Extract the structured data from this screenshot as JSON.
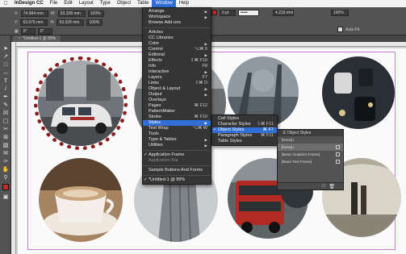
{
  "menubar": {
    "app": "InDesign CC",
    "items": [
      "File",
      "Edit",
      "Layout",
      "Type",
      "Object",
      "Table",
      "Window",
      "Help"
    ]
  },
  "control": {
    "x": "74.984 mm",
    "y": "63.976 mm",
    "w": "63.328 mm",
    "h": "63.328 mm",
    "scale_x": "100%",
    "scale_y": "100%",
    "angle": "0°",
    "shear": "0°",
    "stroke": "0 pt",
    "offset": "4.233 mm",
    "zoom": "100%",
    "autofit": "Auto-Fit"
  },
  "document_tab": "*Untitled-1 @ 89%",
  "window_menu": {
    "items": [
      {
        "label": "Arrange",
        "arrow": true
      },
      {
        "label": "Workspace",
        "arrow": true
      },
      {
        "label": "Browse Add-ons"
      },
      {
        "sep": true
      },
      {
        "label": "Articles"
      },
      {
        "label": "CC Libraries"
      },
      {
        "label": "Color",
        "arrow": true
      },
      {
        "label": "Control",
        "shortcut": "⌥⌘ 6"
      },
      {
        "label": "Editorial",
        "arrow": true
      },
      {
        "label": "Effects",
        "shortcut": "⇧⌘ F10"
      },
      {
        "label": "Info",
        "shortcut": "F8"
      },
      {
        "label": "Interactive",
        "arrow": true
      },
      {
        "label": "Layers",
        "shortcut": "F7"
      },
      {
        "label": "Links",
        "shortcut": "⇧⌘ D"
      },
      {
        "label": "Object & Layout",
        "arrow": true
      },
      {
        "label": "Output",
        "arrow": true
      },
      {
        "label": "Overlays"
      },
      {
        "label": "Pages",
        "shortcut": "⌘ F12"
      },
      {
        "label": "PatternMaker"
      },
      {
        "label": "Stroke",
        "shortcut": "⌘ F10"
      },
      {
        "label": "Styles",
        "arrow": true,
        "highlight": true
      },
      {
        "label": "Text Wrap",
        "shortcut": "⌥⌘ W"
      },
      {
        "label": "Tools"
      },
      {
        "label": "Type & Tables",
        "arrow": true
      },
      {
        "label": "Utilities",
        "arrow": true
      },
      {
        "sep": true
      },
      {
        "label": "Application Frame",
        "check": true
      },
      {
        "label": "Application Bar",
        "disabled": true
      },
      {
        "sep": true
      },
      {
        "label": "Sample Buttons And Forms"
      },
      {
        "sep": true
      },
      {
        "label": "*Untitled-1 @ 89%",
        "check": true
      }
    ]
  },
  "styles_submenu": {
    "items": [
      {
        "label": "Cell Styles"
      },
      {
        "label": "Character Styles",
        "shortcut": "⇧⌘ F11"
      },
      {
        "label": "Object Styles",
        "shortcut": "⌘ F7",
        "highlight": true,
        "check": true
      },
      {
        "label": "Paragraph Styles",
        "shortcut": "⌘ F11"
      },
      {
        "label": "Table Styles"
      }
    ]
  },
  "object_styles_panel": {
    "title": "Object Styles",
    "current": "[None]+",
    "rows": [
      {
        "label": "[None]+",
        "selected": true
      },
      {
        "label": "[Basic Graphics Frame]"
      },
      {
        "label": "[Basic Text Frame]"
      }
    ]
  },
  "images": [
    {
      "name": "london-taxi-photo",
      "colors": [
        "#5a5f63",
        "#b9b9b9",
        "#9a2a2a"
      ]
    },
    {
      "name": "city-street-partial-photo",
      "colors": [
        "#6c6f72",
        "#a0a3a6"
      ]
    },
    {
      "name": "foggy-street-photo",
      "colors": [
        "#586068",
        "#97a0a8"
      ]
    },
    {
      "name": "night-traffic-photo",
      "colors": [
        "#1b1f24",
        "#d8c48a"
      ]
    },
    {
      "name": "coffee-cup-photo",
      "colors": [
        "#7a5a3e",
        "#efe7dc"
      ]
    },
    {
      "name": "skyscraper-photo",
      "colors": [
        "#7f8488",
        "#c9cdd0"
      ]
    },
    {
      "name": "red-bus-photo",
      "colors": [
        "#b32a23",
        "#5d6466"
      ]
    },
    {
      "name": "bus-interior-photo",
      "colors": [
        "#2e3437",
        "#8b8f90"
      ]
    },
    {
      "name": "subway-tunnel-photo",
      "colors": [
        "#8a8476",
        "#d9d4c8"
      ]
    }
  ]
}
